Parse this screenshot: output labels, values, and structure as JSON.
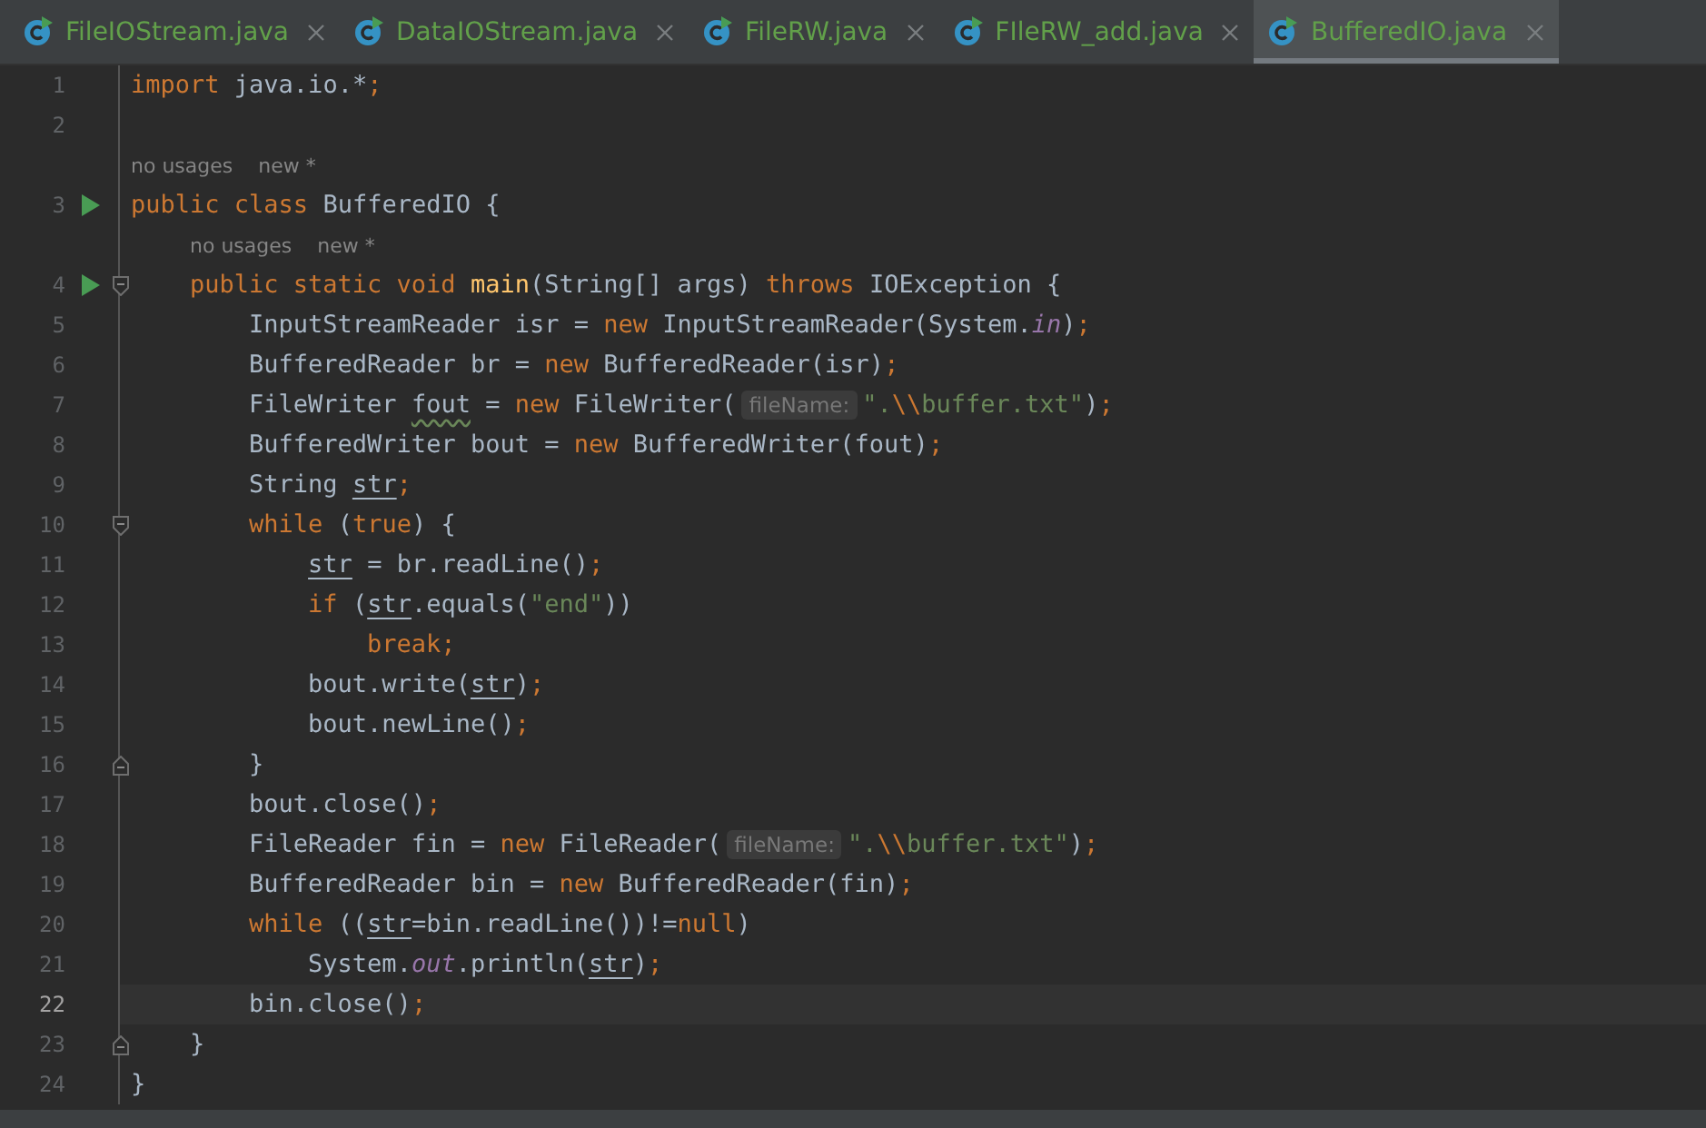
{
  "tabs": [
    {
      "label": "FileIOStream.java",
      "selected": false
    },
    {
      "label": "DataIOStream.java",
      "selected": false
    },
    {
      "label": "FileRW.java",
      "selected": false
    },
    {
      "label": "FIleRW_add.java",
      "selected": false
    },
    {
      "label": "BufferedIO.java",
      "selected": true
    }
  ],
  "editor": {
    "lines": [
      {
        "kind": "code",
        "number": "1",
        "run": false,
        "fold_start": false,
        "fold_end": false,
        "current": false,
        "tokens": [
          {
            "kind": "keyword",
            "text": "import"
          },
          {
            "kind": "plain",
            "text": " java.io.*"
          },
          {
            "kind": "keyword",
            "text": ";"
          }
        ]
      },
      {
        "kind": "code",
        "number": "2",
        "run": false,
        "fold_start": false,
        "fold_end": false,
        "current": false
      },
      {
        "kind": "hint",
        "usages": "no usages",
        "author": "new *"
      },
      {
        "kind": "code",
        "number": "3",
        "run": true,
        "fold_start": false,
        "fold_end": false,
        "current": false,
        "tokens": [
          {
            "kind": "keyword",
            "text": "public class"
          },
          {
            "kind": "plain",
            "text": " BufferedIO {"
          }
        ]
      },
      {
        "kind": "hint",
        "usages": "no usages",
        "author": "new *"
      },
      {
        "kind": "code",
        "number": "4",
        "run": true,
        "fold_start": true,
        "fold_end": false,
        "current": false,
        "tokens": [
          {
            "kind": "keyword",
            "text": "    public static void "
          },
          {
            "kind": "method",
            "text": "main"
          },
          {
            "kind": "plain",
            "text": "(String[] args) "
          },
          {
            "kind": "keyword",
            "text": "throws"
          },
          {
            "kind": "plain",
            "text": " IOException {"
          }
        ]
      },
      {
        "kind": "code",
        "number": "5",
        "run": false,
        "fold_start": false,
        "fold_end": false,
        "current": false,
        "tokens": [
          {
            "kind": "plain",
            "text": "        InputStreamReader isr = "
          },
          {
            "kind": "keyword",
            "text": "new"
          },
          {
            "kind": "plain",
            "text": " InputStreamReader(System."
          },
          {
            "kind": "field",
            "text": "in"
          },
          {
            "kind": "plain",
            "text": ")"
          },
          {
            "kind": "keyword",
            "text": ";"
          }
        ]
      },
      {
        "kind": "code",
        "number": "6",
        "run": false,
        "fold_start": false,
        "fold_end": false,
        "current": false,
        "tokens": [
          {
            "kind": "plain",
            "text": "        BufferedReader br = "
          },
          {
            "kind": "keyword",
            "text": "new"
          },
          {
            "kind": "plain",
            "text": " BufferedReader(isr)"
          },
          {
            "kind": "keyword",
            "text": ";"
          }
        ]
      },
      {
        "kind": "code",
        "number": "7",
        "run": false,
        "fold_start": false,
        "fold_end": false,
        "current": false,
        "tokens": [
          {
            "kind": "plain",
            "text": "        FileWriter "
          },
          {
            "kind": "warning",
            "text": "fout"
          },
          {
            "kind": "plain",
            "text": " = "
          },
          {
            "kind": "keyword",
            "text": "new"
          },
          {
            "kind": "plain",
            "text": " FileWriter("
          },
          {
            "kind": "param",
            "text": "fileName:"
          },
          {
            "kind": "string",
            "text": "\"."
          },
          {
            "kind": "escape",
            "text": "\\\\"
          },
          {
            "kind": "string",
            "text": "buffer.txt\""
          },
          {
            "kind": "plain",
            "text": ")"
          },
          {
            "kind": "keyword",
            "text": ";"
          }
        ]
      },
      {
        "kind": "code",
        "number": "8",
        "run": false,
        "fold_start": false,
        "fold_end": false,
        "current": false,
        "tokens": [
          {
            "kind": "plain",
            "text": "        BufferedWriter bout = "
          },
          {
            "kind": "keyword",
            "text": "new"
          },
          {
            "kind": "plain",
            "text": " BufferedWriter(fout)"
          },
          {
            "kind": "keyword",
            "text": ";"
          }
        ]
      },
      {
        "kind": "code",
        "number": "9",
        "run": false,
        "fold_start": false,
        "fold_end": false,
        "current": false,
        "tokens": [
          {
            "kind": "plain",
            "text": "        String "
          },
          {
            "kind": "reassigned",
            "text": "str"
          },
          {
            "kind": "keyword",
            "text": ";"
          }
        ]
      },
      {
        "kind": "code",
        "number": "10",
        "run": false,
        "fold_start": true,
        "fold_end": false,
        "current": false,
        "tokens": [
          {
            "kind": "keyword",
            "text": "        while"
          },
          {
            "kind": "plain",
            "text": " ("
          },
          {
            "kind": "keyword",
            "text": "true"
          },
          {
            "kind": "plain",
            "text": ") {"
          }
        ]
      },
      {
        "kind": "code",
        "number": "11",
        "run": false,
        "fold_start": false,
        "fold_end": false,
        "current": false,
        "tokens": [
          {
            "kind": "reassigned",
            "text": "            str"
          },
          {
            "kind": "plain",
            "text": " = br.readLine()"
          },
          {
            "kind": "keyword",
            "text": ";"
          }
        ]
      },
      {
        "kind": "code",
        "number": "12",
        "run": false,
        "fold_start": false,
        "fold_end": false,
        "current": false,
        "tokens": [
          {
            "kind": "keyword",
            "text": "            if"
          },
          {
            "kind": "plain",
            "text": " ("
          },
          {
            "kind": "reassigned",
            "text": "str"
          },
          {
            "kind": "plain",
            "text": ".equals("
          },
          {
            "kind": "string",
            "text": "\"end\""
          },
          {
            "kind": "plain",
            "text": "))"
          }
        ]
      },
      {
        "kind": "code",
        "number": "13",
        "run": false,
        "fold_start": false,
        "fold_end": false,
        "current": false,
        "tokens": [
          {
            "kind": "keyword",
            "text": "                break;"
          }
        ]
      },
      {
        "kind": "code",
        "number": "14",
        "run": false,
        "fold_start": false,
        "fold_end": false,
        "current": false,
        "tokens": [
          {
            "kind": "plain",
            "text": "            bout.write("
          },
          {
            "kind": "reassigned",
            "text": "str"
          },
          {
            "kind": "plain",
            "text": ")"
          },
          {
            "kind": "keyword",
            "text": ";"
          }
        ]
      },
      {
        "kind": "code",
        "number": "15",
        "run": false,
        "fold_start": false,
        "fold_end": false,
        "current": false,
        "tokens": [
          {
            "kind": "plain",
            "text": "            bout.newLine()"
          },
          {
            "kind": "keyword",
            "text": ";"
          }
        ]
      },
      {
        "kind": "code",
        "number": "16",
        "run": false,
        "fold_start": false,
        "fold_end": true,
        "current": false,
        "tokens": [
          {
            "kind": "plain",
            "text": "        }"
          }
        ]
      },
      {
        "kind": "code",
        "number": "17",
        "run": false,
        "fold_start": false,
        "fold_end": false,
        "current": false,
        "tokens": [
          {
            "kind": "plain",
            "text": "        bout.close()"
          },
          {
            "kind": "keyword",
            "text": ";"
          }
        ]
      },
      {
        "kind": "code",
        "number": "18",
        "run": false,
        "fold_start": false,
        "fold_end": false,
        "current": false,
        "tokens": [
          {
            "kind": "plain",
            "text": "        FileReader fin = "
          },
          {
            "kind": "keyword",
            "text": "new"
          },
          {
            "kind": "plain",
            "text": " FileReader("
          },
          {
            "kind": "param",
            "text": "fileName:"
          },
          {
            "kind": "string",
            "text": "\"."
          },
          {
            "kind": "escape",
            "text": "\\\\"
          },
          {
            "kind": "string",
            "text": "buffer.txt\""
          },
          {
            "kind": "plain",
            "text": ")"
          },
          {
            "kind": "keyword",
            "text": ";"
          }
        ]
      },
      {
        "kind": "code",
        "number": "19",
        "run": false,
        "fold_start": false,
        "fold_end": false,
        "current": false,
        "tokens": [
          {
            "kind": "plain",
            "text": "        BufferedReader bin = "
          },
          {
            "kind": "keyword",
            "text": "new"
          },
          {
            "kind": "plain",
            "text": " BufferedReader(fin)"
          },
          {
            "kind": "keyword",
            "text": ";"
          }
        ]
      },
      {
        "kind": "code",
        "number": "20",
        "run": false,
        "fold_start": false,
        "fold_end": false,
        "current": false,
        "tokens": [
          {
            "kind": "keyword",
            "text": "        while"
          },
          {
            "kind": "plain",
            "text": " (("
          },
          {
            "kind": "reassigned",
            "text": "str"
          },
          {
            "kind": "plain",
            "text": "=bin.readLine())!="
          },
          {
            "kind": "keyword",
            "text": "null"
          },
          {
            "kind": "plain",
            "text": ")"
          }
        ]
      },
      {
        "kind": "code",
        "number": "21",
        "run": false,
        "fold_start": false,
        "fold_end": false,
        "current": false,
        "tokens": [
          {
            "kind": "plain",
            "text": "            System."
          },
          {
            "kind": "field",
            "text": "out"
          },
          {
            "kind": "plain",
            "text": ".println("
          },
          {
            "kind": "reassigned",
            "text": "str"
          },
          {
            "kind": "plain",
            "text": ")"
          },
          {
            "kind": "keyword",
            "text": ";"
          }
        ]
      },
      {
        "kind": "code",
        "number": "22",
        "run": false,
        "fold_start": false,
        "fold_end": false,
        "current": true,
        "tokens": [
          {
            "kind": "plain",
            "text": "        bin.close()"
          },
          {
            "kind": "keyword",
            "text": ";"
          }
        ]
      },
      {
        "kind": "code",
        "number": "23",
        "run": false,
        "fold_start": false,
        "fold_end": true,
        "current": false,
        "tokens": [
          {
            "kind": "plain",
            "text": "    }"
          }
        ]
      },
      {
        "kind": "code",
        "number": "24",
        "run": false,
        "fold_start": false,
        "fold_end": false,
        "current": false,
        "tokens": [
          {
            "kind": "plain",
            "text": "}"
          }
        ]
      }
    ]
  }
}
